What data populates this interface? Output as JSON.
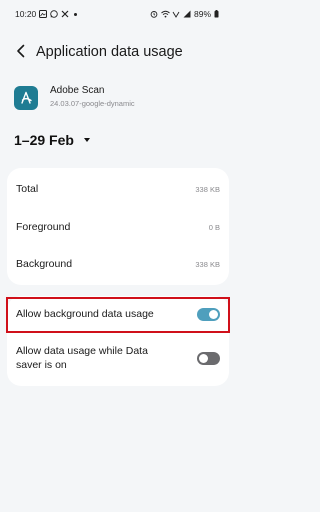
{
  "status_bar": {
    "time": "10:20",
    "battery": "89%",
    "left_icons": [
      "gallery-icon",
      "whatsapp-icon",
      "x-icon",
      "dot-icon"
    ],
    "right_icons": [
      "alarm-icon",
      "wifi-icon",
      "volte-icon",
      "signal-icon",
      "battery-icon"
    ]
  },
  "header": {
    "title": "Application data usage",
    "back_icon": "back-arrow-icon"
  },
  "app": {
    "name": "Adobe Scan",
    "version": "24.03.07-google-dynamic",
    "icon": "adobe-scan-icon",
    "icon_color": "#1f7c93"
  },
  "date_range": {
    "label": "1–29 Feb"
  },
  "usage": {
    "rows": [
      {
        "label": "Total",
        "value": "338 KB"
      },
      {
        "label": "Foreground",
        "value": "0 B"
      },
      {
        "label": "Background",
        "value": "338 KB"
      }
    ]
  },
  "settings": {
    "background_data": {
      "label": "Allow background data usage",
      "enabled": true
    },
    "data_saver": {
      "label": "Allow data usage while Data saver is on",
      "enabled": false
    }
  },
  "colors": {
    "accent": "#4f9fbd",
    "highlight": "#d0101a",
    "toggle_off": "#6b6b6e"
  }
}
